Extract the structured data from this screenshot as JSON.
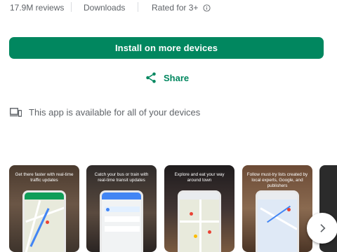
{
  "stats": {
    "reviews": "17.9M reviews",
    "downloads": "Downloads",
    "rating": "Rated for 3+"
  },
  "actions": {
    "install_label": "Install on more devices",
    "share_label": "Share"
  },
  "availability": {
    "text": "This app is available for all of your devices"
  },
  "screenshots": [
    {
      "caption": "Get there faster with real-time traffic updates"
    },
    {
      "caption": "Catch your bus or train with real-time transit updates"
    },
    {
      "caption": "Explore and eat your way around town"
    },
    {
      "caption": "Follow must-try lists created by local experts, Google, and publishers"
    }
  ],
  "colors": {
    "accent": "#01875f",
    "text_secondary": "#5f6368"
  },
  "icons": {
    "rating_info": "info-icon",
    "share": "share-icon",
    "devices": "devices-icon",
    "next": "chevron-right-icon"
  }
}
